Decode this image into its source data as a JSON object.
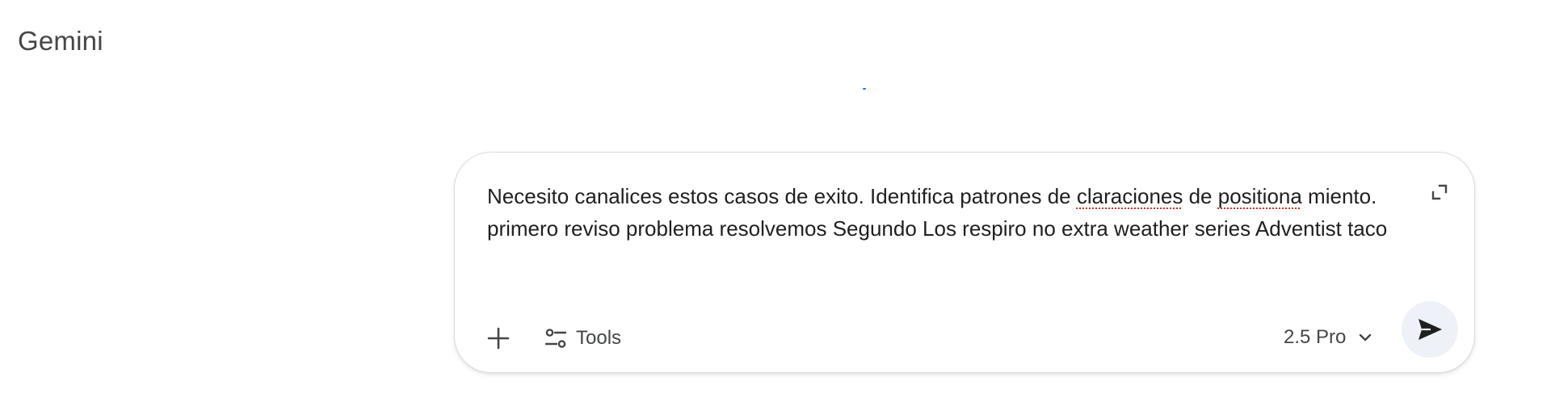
{
  "app": {
    "title": "Gemini"
  },
  "composer": {
    "prompt_segments": [
      {
        "text": "Necesito canalices estos casos de exito. Identifica patrones de ",
        "misspelled": false
      },
      {
        "text": "claraciones",
        "misspelled": true
      },
      {
        "text": " de ",
        "misspelled": false
      },
      {
        "text": "positiona",
        "misspelled": true
      },
      {
        "text": " miento. primero reviso problema resolvemos Segundo Los respiro no extra weather series Adventist taco",
        "misspelled": false
      }
    ],
    "expand_icon": "expand-icon",
    "add_icon": "plus-icon",
    "tools": {
      "label": "Tools",
      "icon": "tune-icon"
    },
    "model_selector": {
      "selected": "2.5 Pro",
      "icon": "chevron-down-icon"
    },
    "send_icon": "send-icon"
  },
  "colors": {
    "title": "#444746",
    "text": "#1f1f1f",
    "accent_dot": "#1a73e8",
    "send_bg": "#eef2f8",
    "spellcheck": "#d93025"
  }
}
